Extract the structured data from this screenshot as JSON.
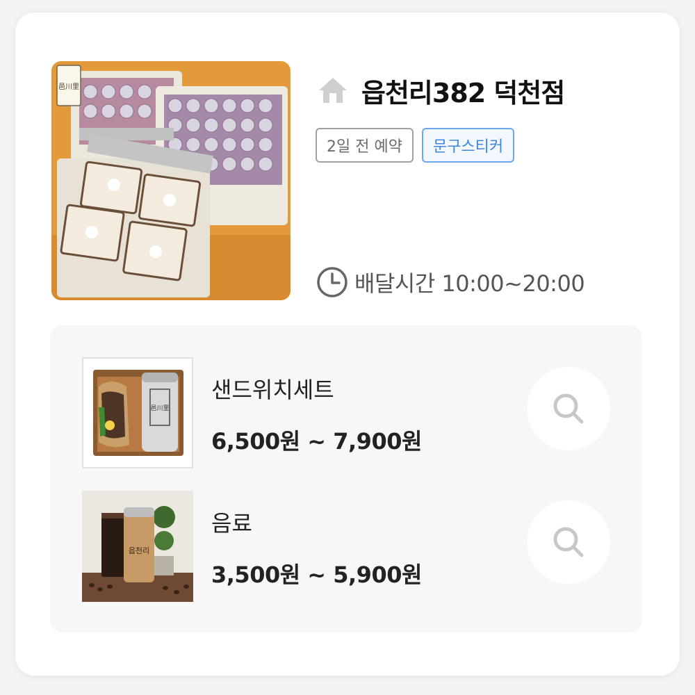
{
  "store": {
    "name": "읍천리382 덕천점",
    "home_icon": "home-icon",
    "badges": [
      "2일 전 예약",
      "문구스티커"
    ],
    "delivery": "배달시간 10:00~20:00",
    "clock_icon": "clock-icon",
    "photo_logo": "邑川里"
  },
  "menu": [
    {
      "name": "샌드위치세트",
      "price": "6,500원 ~ 7,900원",
      "thumb_logo": "邑川里",
      "icon": "search-icon"
    },
    {
      "name": "음료",
      "price": "3,500원 ~ 5,900원",
      "thumb_logo": "읍천리",
      "icon": "search-icon"
    }
  ],
  "colors": {
    "accent_blue": "#3d86df",
    "badge_gray": "#6b6b6b",
    "panel_bg": "#f7f7f7"
  }
}
